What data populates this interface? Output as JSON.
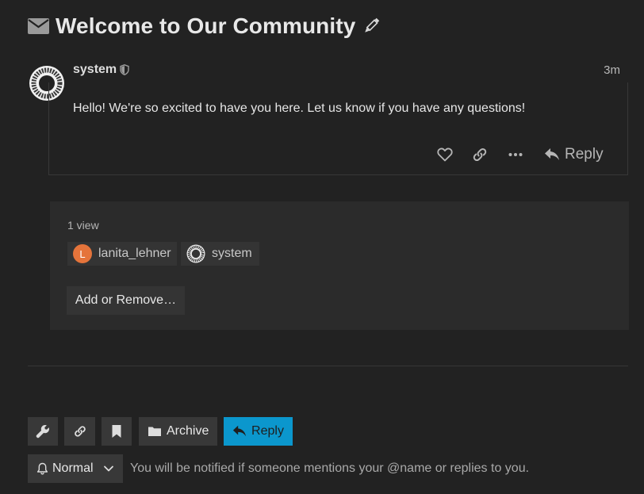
{
  "topic": {
    "title": "Welcome to Our Community",
    "icons": [
      "envelope-icon",
      "pencil-icon"
    ]
  },
  "post": {
    "username": "system",
    "time": "3m",
    "body": "Hello! We're so excited to have you here. Let us know if you have any questions!",
    "actions": {
      "reply_label": "Reply"
    }
  },
  "topic_map": {
    "views": "1 view",
    "participants": [
      {
        "name": "lanita_lehner",
        "avatar_letter": "L",
        "avatar_color": "#e5743b"
      },
      {
        "name": "system"
      }
    ],
    "add_remove_label": "Add or Remove…"
  },
  "footer": {
    "archive_label": "Archive",
    "reply_label": "Reply",
    "notification_level": "Normal",
    "notification_text": "You will be notified if someone mentions your @name or replies to you."
  },
  "colors": {
    "background": "#222222",
    "primary_button": "#0b97cd",
    "avatar_letter_bg": "#e5743b"
  }
}
